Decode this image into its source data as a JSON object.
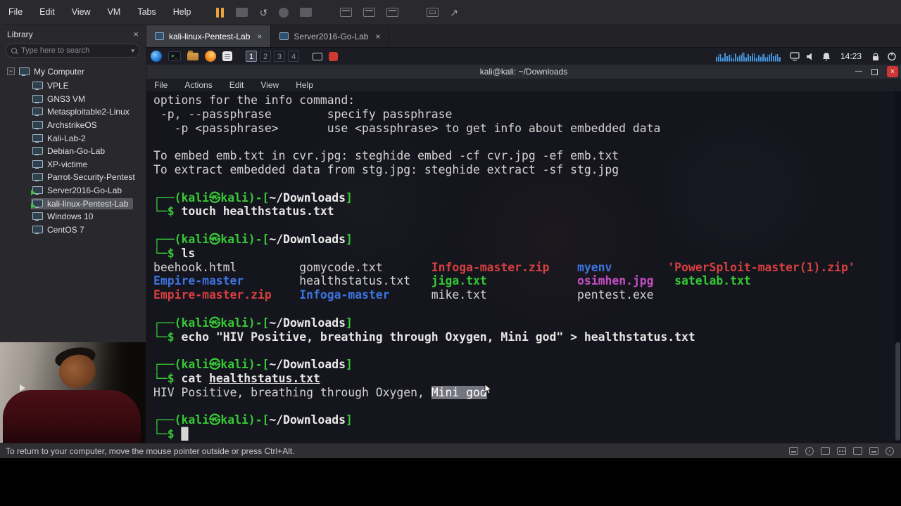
{
  "icons": {
    "close": "×",
    "minimize": "—",
    "dropdown": "▾",
    "collapse": "−",
    "revert": "↺",
    "unity": "↗",
    "terminal_glyph": ">_",
    "running_play": "▶",
    "cursor_block": "█"
  },
  "colors": {
    "pause_orange": "#e8a33d",
    "prompt_green": "#36c936",
    "directory_blue": "#3c74e0",
    "archive_red": "#d64040",
    "image_magenta": "#c44ec4",
    "executable_green": "#34c934",
    "running_badge_green": "#35c435",
    "close_button_red": "#cf3535",
    "visualizer_blue": "#4597e0"
  },
  "vmware": {
    "menu": [
      "File",
      "Edit",
      "View",
      "VM",
      "Tabs",
      "Help"
    ],
    "library": {
      "title": "Library",
      "search_placeholder": "Type here to search",
      "root_label": "My Computer",
      "items": [
        {
          "label": "VPLE",
          "running": false,
          "selected": false
        },
        {
          "label": "GNS3 VM",
          "running": false,
          "selected": false
        },
        {
          "label": "Metasploitable2-Linux",
          "running": false,
          "selected": false
        },
        {
          "label": "ArchstrikeOS",
          "running": false,
          "selected": false
        },
        {
          "label": "Kali-Lab-2",
          "running": false,
          "selected": false
        },
        {
          "label": "Debian-Go-Lab",
          "running": false,
          "selected": false
        },
        {
          "label": "XP-victime",
          "running": false,
          "selected": false
        },
        {
          "label": "Parrot-Security-Pentest",
          "running": false,
          "selected": false
        },
        {
          "label": "Server2016-Go-Lab",
          "running": true,
          "selected": false
        },
        {
          "label": "kali-linux-Pentest-Lab",
          "running": true,
          "selected": true
        },
        {
          "label": "Windows 10",
          "running": false,
          "selected": false
        },
        {
          "label": "CentOS 7",
          "running": false,
          "selected": false
        }
      ]
    },
    "tabs": [
      {
        "label": "kali-linux-Pentest-Lab",
        "active": true
      },
      {
        "label": "Server2016-Go-Lab",
        "active": false
      }
    ],
    "hint_bar": "To return to your computer, move the mouse pointer outside or press Ctrl+Alt."
  },
  "kali_panel": {
    "workspaces": [
      "1",
      "2",
      "3",
      "4"
    ],
    "active_workspace": "1",
    "clock": "14:23"
  },
  "terminal": {
    "title": "kali@kali: ~/Downloads",
    "menu": [
      "File",
      "Actions",
      "Edit",
      "View",
      "Help"
    ],
    "lines": [
      {
        "s": [
          {
            "t": "options for the info command:"
          }
        ]
      },
      {
        "s": [
          {
            "t": " -p, --passphrase        specify passphrase"
          }
        ]
      },
      {
        "s": [
          {
            "t": "   -p <passphrase>       use <passphrase> to get info about embedded data"
          }
        ]
      },
      {
        "s": []
      },
      {
        "s": [
          {
            "t": "To embed emb.txt in cvr.jpg: steghide embed -cf cvr.jpg -ef emb.txt"
          }
        ]
      },
      {
        "s": [
          {
            "t": "To extract embedded data from stg.jpg: steghide extract -sf stg.jpg"
          }
        ]
      },
      {
        "s": []
      },
      {
        "s": [
          {
            "t": "┌──(kali㉿kali)-[",
            "c": "p"
          },
          {
            "t": "~/Downloads",
            "c": "pw"
          },
          {
            "t": "]",
            "c": "p"
          }
        ]
      },
      {
        "s": [
          {
            "t": "└─$ ",
            "c": "p"
          },
          {
            "t": "touch healthstatus.txt",
            "c": "c"
          }
        ]
      },
      {
        "s": []
      },
      {
        "s": [
          {
            "t": "┌──(kali㉿kali)-[",
            "c": "p"
          },
          {
            "t": "~/Downloads",
            "c": "pw"
          },
          {
            "t": "]",
            "c": "p"
          }
        ]
      },
      {
        "s": [
          {
            "t": "└─$ ",
            "c": "p"
          },
          {
            "t": "ls",
            "c": "c"
          }
        ]
      },
      {
        "s": [
          {
            "t": "beehook.html         "
          },
          {
            "t": "gomycode.txt       "
          },
          {
            "t": "Infoga-master.zip",
            "c": "arc"
          },
          {
            "t": "    "
          },
          {
            "t": "myenv",
            "c": "dir"
          },
          {
            "t": "        "
          },
          {
            "t": "'PowerSploit-master(1).zip'",
            "c": "arc"
          }
        ]
      },
      {
        "s": [
          {
            "t": "Empire-master",
            "c": "dir"
          },
          {
            "t": "        "
          },
          {
            "t": "healthstatus.txt   "
          },
          {
            "t": "jiga.txt",
            "c": "exe"
          },
          {
            "t": "             "
          },
          {
            "t": "osimhen.jpg",
            "c": "img"
          },
          {
            "t": "   "
          },
          {
            "t": "satelab.txt",
            "c": "exe"
          }
        ]
      },
      {
        "s": [
          {
            "t": "Empire-master.zip",
            "c": "arc"
          },
          {
            "t": "    "
          },
          {
            "t": "Infoga-master",
            "c": "dir"
          },
          {
            "t": "      "
          },
          {
            "t": "mike.txt             "
          },
          {
            "t": "pentest.exe"
          }
        ]
      },
      {
        "s": []
      },
      {
        "s": [
          {
            "t": "┌──(kali㉿kali)-[",
            "c": "p"
          },
          {
            "t": "~/Downloads",
            "c": "pw"
          },
          {
            "t": "]",
            "c": "p"
          }
        ]
      },
      {
        "s": [
          {
            "t": "└─$ ",
            "c": "p"
          },
          {
            "t": "echo \"HIV Positive, breathing through Oxygen, Mini god\" > healthstatus.txt",
            "c": "c"
          }
        ]
      },
      {
        "s": []
      },
      {
        "s": [
          {
            "t": "┌──(kali㉿kali)-[",
            "c": "p"
          },
          {
            "t": "~/Downloads",
            "c": "pw"
          },
          {
            "t": "]",
            "c": "p"
          }
        ]
      },
      {
        "s": [
          {
            "t": "└─$ ",
            "c": "p"
          },
          {
            "t": "cat ",
            "c": "c"
          },
          {
            "t": "healthstatus.txt",
            "c": "cu"
          }
        ]
      },
      {
        "s": [
          {
            "t": "HIV Positive, breathing through Oxygen, "
          },
          {
            "t": "Mini god",
            "c": "sel"
          }
        ]
      },
      {
        "s": []
      },
      {
        "s": [
          {
            "t": "┌──(kali㉿kali)-[",
            "c": "p"
          },
          {
            "t": "~/Downloads",
            "c": "pw"
          },
          {
            "t": "]",
            "c": "p"
          }
        ]
      },
      {
        "s": [
          {
            "t": "└─$ ",
            "c": "p"
          },
          {
            "t": "█",
            "c": "cur"
          }
        ]
      }
    ]
  }
}
